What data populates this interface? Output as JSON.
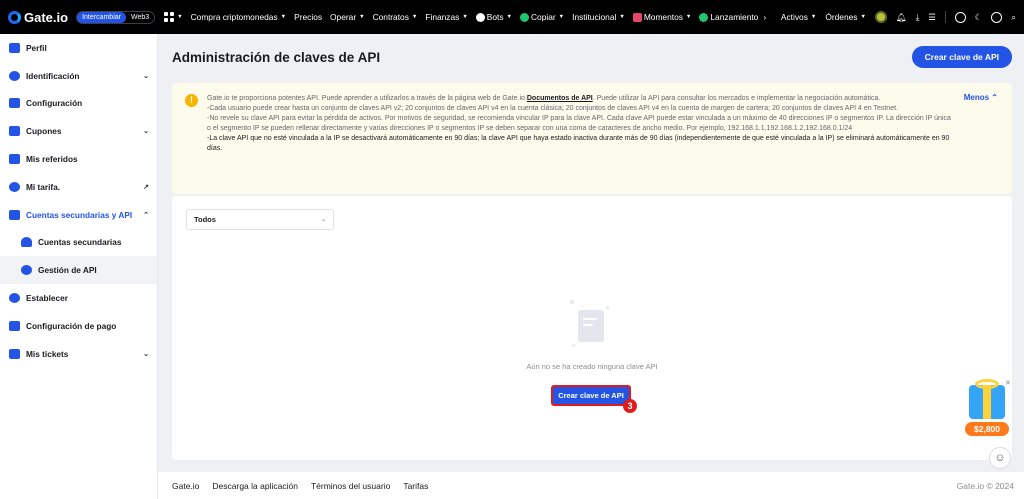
{
  "topbar": {
    "brand": "Gate.io",
    "toggle": [
      "Intercambiar",
      "Web3"
    ],
    "nav": [
      {
        "label": "Compra criptomonedas",
        "caret": true
      },
      {
        "label": "Precios",
        "caret": false
      },
      {
        "label": "Operar",
        "caret": true
      },
      {
        "label": "Contratos",
        "caret": true
      },
      {
        "label": "Finanzas",
        "caret": true
      },
      {
        "label": "Bots",
        "caret": true
      },
      {
        "label": "Copiar",
        "caret": true
      },
      {
        "label": "Institucional",
        "caret": true
      },
      {
        "label": "Momentos",
        "caret": true
      },
      {
        "label": "Lanzamiento",
        "caret": false
      }
    ],
    "right": [
      "Activos",
      "Órdenes"
    ]
  },
  "sidebar": {
    "items": [
      {
        "label": "Perfil",
        "chev": ""
      },
      {
        "label": "Identificación",
        "chev": "⌄"
      },
      {
        "label": "Configuración",
        "chev": ""
      },
      {
        "label": "Cupones",
        "chev": "⌄"
      },
      {
        "label": "Mis referidos",
        "chev": ""
      },
      {
        "label": "Mi tarifa.",
        "chev": "↗"
      },
      {
        "label": "Cuentas secundarias y API",
        "chev": "⌃"
      },
      {
        "label": "Cuentas secundarias",
        "chev": ""
      },
      {
        "label": "Gestión de API",
        "chev": ""
      },
      {
        "label": "Establecer",
        "chev": ""
      },
      {
        "label": "Configuración de pago",
        "chev": ""
      },
      {
        "label": "Mis tickets",
        "chev": "⌄"
      }
    ]
  },
  "main": {
    "title": "Administración de claves de API",
    "create_button": "Crear clave de API",
    "notice": {
      "p1_pre": "Gate.io te proporciona potentes API. Puede aprender a utilizarlos a través de la página web de Gate.io ",
      "p1_link": "Documentos de API",
      "p1_post": ". Puede utilizar la API para consultar los mercados e implementar la negociación automática.",
      "p2": "-Cada usuario puede crear hasta un conjunto de claves API v2; 20 conjuntos de claves API v4 en la cuenta clásica; 20 conjuntos de claves API v4 en la cuenta de margen de cartera; 20 conjuntos de claves API 4 en Testnet.",
      "p3": "-No revele su clave API para evitar la pérdida de activos. Por motivos de seguridad, se recomienda vincular IP para la clave API. Cada clave API puede estar vinculada a un máximo de 40 direcciones IP o segmentos IP. La dirección IP única o el segmento IP se pueden rellenar directamente y varias direcciones IP o segmentos IP se deben separar con una coma de caracteres de ancho medio. Por ejemplo, 192.168.1.1,192.168.1.2,192.168.0.1/24",
      "p4": "-La clave API que no esté vinculada a la IP se desactivará automáticamente en 90 días; la clave API que haya estado inactiva durante más de 90 días (independientemente de que esté vinculada a la IP) se eliminará automáticamente en 90 días.",
      "toggle": "Menos"
    },
    "filter_select": "Todos",
    "empty_text": "Aún no se ha creado ninguna clave API",
    "empty_button": "Crear clave de API",
    "step_badge": "3"
  },
  "footer": {
    "links": [
      "Gate.io",
      "Descarga la aplicación",
      "Términos del usuario",
      "Tarifas"
    ],
    "copyright": "Gate.io © 2024"
  },
  "promo": {
    "price": "$2,800"
  },
  "colors": {
    "accent": "#2354e6",
    "highlight": "#e01b1b",
    "notice_bg": "#fdfbeb"
  }
}
